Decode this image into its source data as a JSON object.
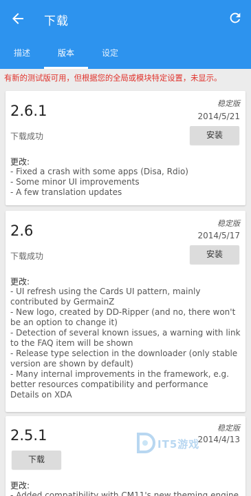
{
  "appbar": {
    "title": "下载"
  },
  "tabs": [
    {
      "label": "描述"
    },
    {
      "label": "版本"
    },
    {
      "label": "设定"
    }
  ],
  "warning": "有新的测试版可用，但根据您的全局或模块特定设置，未显示。",
  "versions": [
    {
      "version": "2.6.1",
      "type": "稳定版",
      "date": "2014/5/21",
      "status": "下载成功",
      "button": "安装",
      "changes_label": "更改:",
      "changes": "- Fixed a crash with some apps (Disa, Rdio)\n- Some minor UI improvements\n- A few translation updates"
    },
    {
      "version": "2.6",
      "type": "稳定版",
      "date": "2014/5/17",
      "status": "下载成功",
      "button": "安装",
      "changes_label": "更改:",
      "changes": "- UI refresh using the Cards UI pattern, mainly contributed by GermainZ\n- New logo, created by DD-Ripper (and no, there won't be an option to change it)\n- Detection of several known issues, a warning with link to the FAQ item will be shown\n- Release type selection in the downloader (only stable version are shown by default)\n- Many internal improvements in the framework, e.g. better resources compatibility and performance\nDetails on XDA"
    },
    {
      "version": "2.5.1",
      "type": "稳定版",
      "date": "2014/4/13",
      "button": "下载",
      "changes_label": "更改:",
      "changes": "- Added compatibility with CM11's new theming engine"
    }
  ],
  "watermark": {
    "text": "IT5游戏"
  },
  "colors": {
    "appbar": "#2d93ee",
    "warning": "#e0322b",
    "background": "#ececec"
  }
}
